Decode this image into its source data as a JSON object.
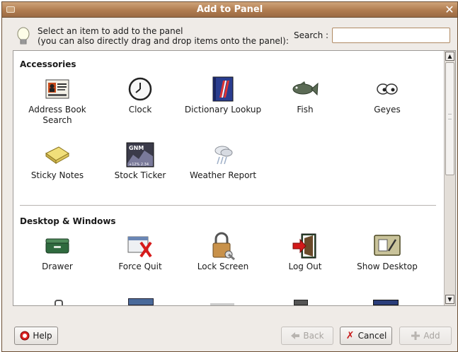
{
  "window": {
    "title": "Add to Panel"
  },
  "header": {
    "line1": "Select an item to add to the panel",
    "line2": "(you can also directly drag and drop items onto the panel):",
    "search_label": "Search :",
    "search_value": ""
  },
  "sections": [
    {
      "title": "Accessories",
      "items": [
        {
          "label": "Address Book Search",
          "icon": "address-book-icon"
        },
        {
          "label": "Clock",
          "icon": "clock-icon"
        },
        {
          "label": "Dictionary Lookup",
          "icon": "dictionary-icon"
        },
        {
          "label": "Fish",
          "icon": "fish-icon"
        },
        {
          "label": "Geyes",
          "icon": "eyes-icon"
        },
        {
          "label": "Sticky Notes",
          "icon": "sticky-notes-icon"
        },
        {
          "label": "Stock Ticker",
          "icon": "stock-ticker-icon",
          "icon_text": "GNM",
          "icon_subtext": "+12% 2.34"
        },
        {
          "label": "Weather Report",
          "icon": "weather-icon"
        }
      ]
    },
    {
      "title": "Desktop & Windows",
      "items": [
        {
          "label": "Drawer",
          "icon": "drawer-icon"
        },
        {
          "label": "Force Quit",
          "icon": "force-quit-icon"
        },
        {
          "label": "Lock Screen",
          "icon": "lock-screen-icon"
        },
        {
          "label": "Log Out",
          "icon": "log-out-icon"
        },
        {
          "label": "Show Desktop",
          "icon": "show-desktop-icon"
        }
      ]
    }
  ],
  "buttons": {
    "help": "Help",
    "back": "Back",
    "cancel": "Cancel",
    "add": "Add"
  }
}
